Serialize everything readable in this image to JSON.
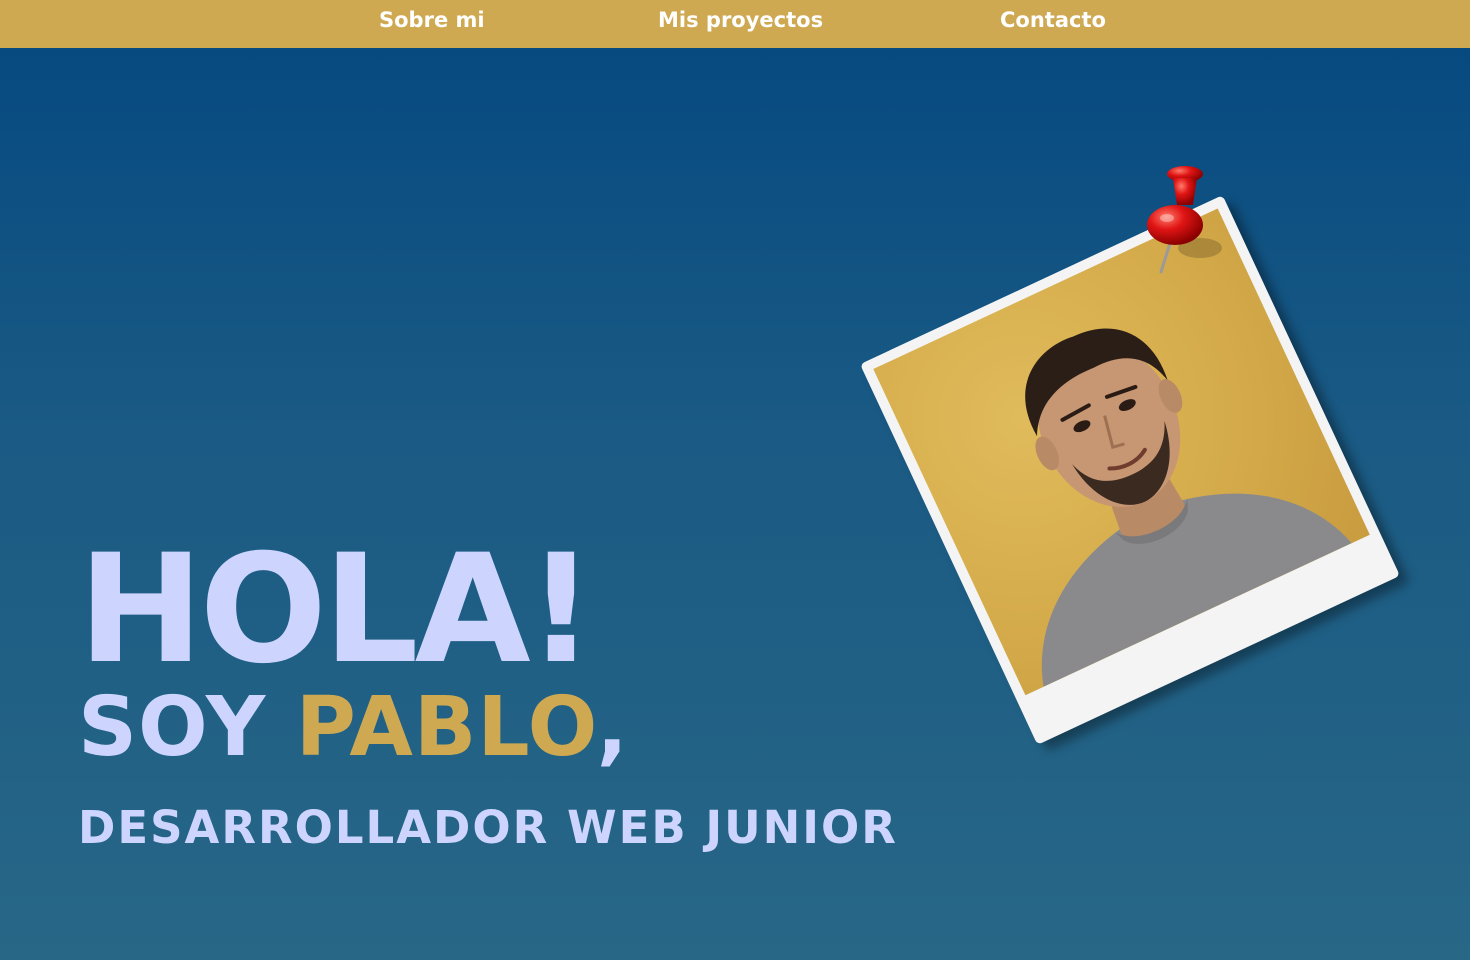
{
  "nav": {
    "items": [
      {
        "label": "Sobre mi"
      },
      {
        "label": "Mis proyectos"
      },
      {
        "label": "Contacto"
      }
    ]
  },
  "hero": {
    "greeting": "HOLA!",
    "intro_prefix": "SOY ",
    "name": "PABLO",
    "intro_suffix": ",",
    "role": "DESARROLLADOR WEB JUNIOR"
  },
  "colors": {
    "nav_bg": "#cfa951",
    "accent": "#cfa951",
    "text_light": "#cdd5fe",
    "bg_top": "#044880",
    "bg_bottom": "#286786"
  },
  "icons": {
    "pin": "push-pin-icon"
  }
}
